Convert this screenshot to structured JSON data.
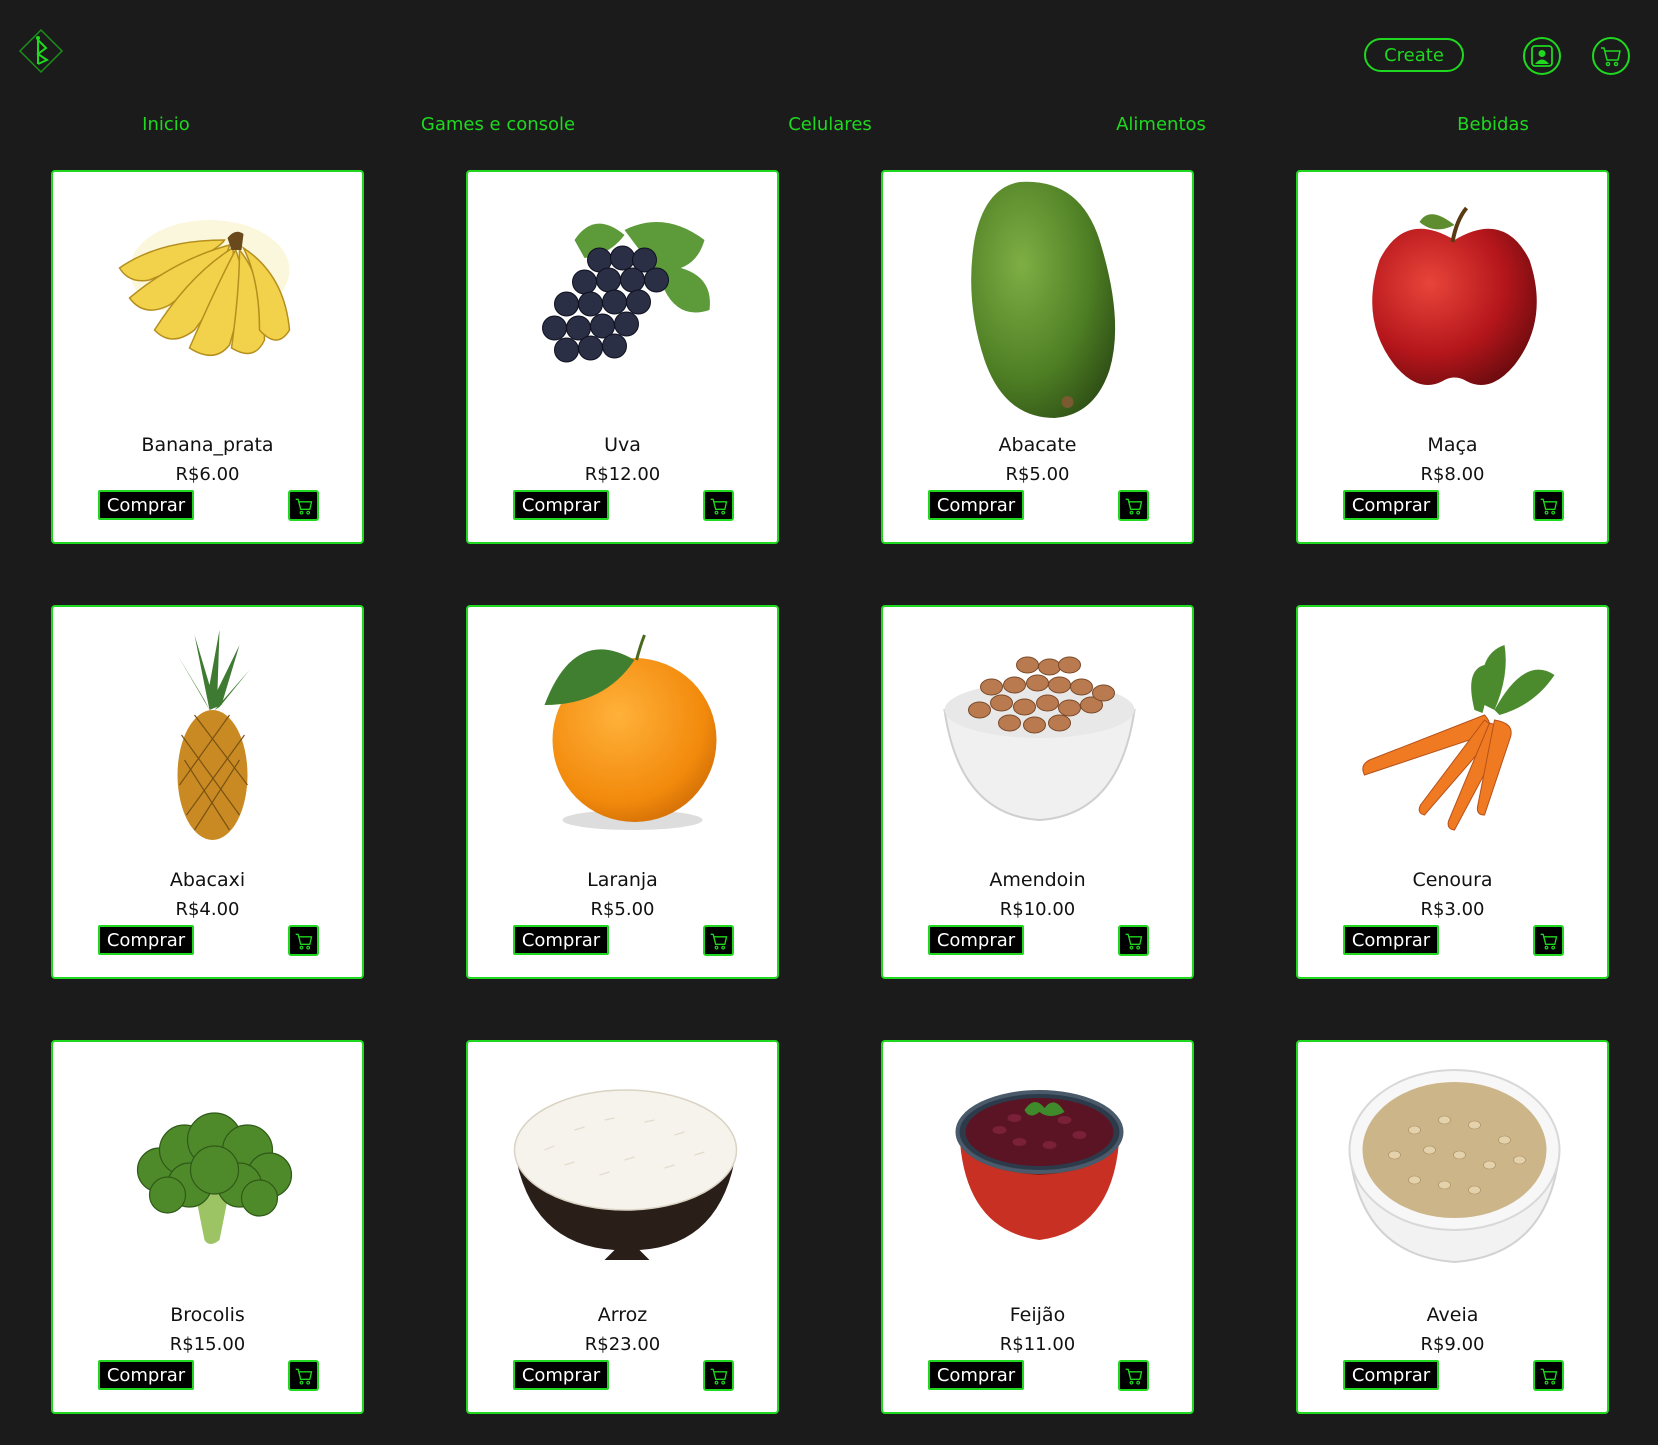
{
  "header": {
    "create_label": "Create"
  },
  "nav": {
    "items": [
      {
        "label": "Inicio"
      },
      {
        "label": "Games e console"
      },
      {
        "label": "Celulares"
      },
      {
        "label": "Alimentos"
      },
      {
        "label": "Bebidas"
      }
    ]
  },
  "products": [
    {
      "name": "Banana_prata",
      "price": "R$6.00",
      "buy_label": "Comprar",
      "icon": "banana-image"
    },
    {
      "name": "Uva",
      "price": "R$12.00",
      "buy_label": "Comprar",
      "icon": "grapes-image"
    },
    {
      "name": "Abacate",
      "price": "R$5.00",
      "buy_label": "Comprar",
      "icon": "avocado-image"
    },
    {
      "name": "Maça",
      "price": "R$8.00",
      "buy_label": "Comprar",
      "icon": "apple-image"
    },
    {
      "name": "Abacaxi",
      "price": "R$4.00",
      "buy_label": "Comprar",
      "icon": "pineapple-image"
    },
    {
      "name": "Laranja",
      "price": "R$5.00",
      "buy_label": "Comprar",
      "icon": "orange-image"
    },
    {
      "name": "Amendoin",
      "price": "R$10.00",
      "buy_label": "Comprar",
      "icon": "peanuts-image"
    },
    {
      "name": "Cenoura",
      "price": "R$3.00",
      "buy_label": "Comprar",
      "icon": "carrots-image"
    },
    {
      "name": "Brocolis",
      "price": "R$15.00",
      "buy_label": "Comprar",
      "icon": "broccoli-image"
    },
    {
      "name": "Arroz",
      "price": "R$23.00",
      "buy_label": "Comprar",
      "icon": "rice-image"
    },
    {
      "name": "Feijão",
      "price": "R$11.00",
      "buy_label": "Comprar",
      "icon": "beans-image"
    },
    {
      "name": "Aveia",
      "price": "R$9.00",
      "buy_label": "Comprar",
      "icon": "oats-image"
    }
  ],
  "colors": {
    "background": "#1b1b1b",
    "accent": "#1fd81f",
    "card": "#ffffff"
  }
}
